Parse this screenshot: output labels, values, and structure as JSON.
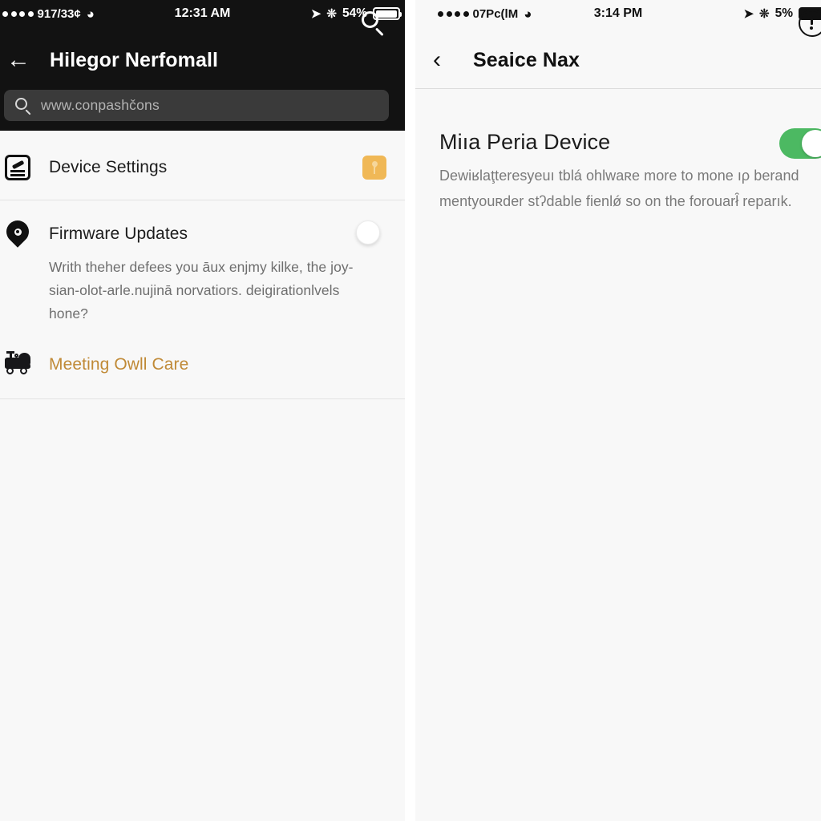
{
  "left": {
    "status_bar": {
      "signal_dots": 4,
      "carrier": "917/33¢",
      "wifi_icon": "wifi-icon",
      "time": "12:31 AM",
      "location_icon": "location-arrow-icon",
      "bluetooth_icon": "bluetooth-icon",
      "battery_percent": "54%"
    },
    "nav": {
      "back_icon": "arrow-left-icon",
      "title": "Hilegor Nerfomall",
      "search_icon": "search-icon"
    },
    "search": {
      "icon": "search-icon",
      "placeholder": "www.conpashčons",
      "value": "www.conpashčons"
    },
    "items": [
      {
        "icon": "device-settings-icon",
        "title": "Device Settings",
        "desc": "",
        "badge": "map-pin-badge",
        "accent": false
      },
      {
        "icon": "location-pin-icon",
        "title": "Firmware Updates",
        "desc": "Writh theher defees you āux enjmy kilke, the joy-sian-olot-arle.nujinā norvatiors. deigirationlvels hone?",
        "toggle": "circle-toggle-off",
        "accent": false
      },
      {
        "icon": "owl-cart-icon",
        "title": "Meeting Owll Care",
        "desc": "",
        "accent": true
      }
    ]
  },
  "right": {
    "status_bar": {
      "signal_dots": 4,
      "carrier": "07Pc(lM",
      "wifi_icon": "wifi-icon",
      "time": "3:14 PM",
      "location_icon": "location-arrow-icon",
      "bluetooth_icon": "bluetooth-icon",
      "battery_percent": "5%"
    },
    "nav": {
      "back_icon": "chevron-left-icon",
      "title": "Seaice Nax",
      "info_icon": "info-circle-icon"
    },
    "item": {
      "title": "Miıa Peria Device",
      "desc": "Dewiʁlaţteresуeuı tblá ohlwaʀe more to mone ıρ berand mentyouʀder stʔdable fienlǿ so on the forouarł̑ reparık.",
      "toggle_state": "on"
    }
  },
  "colors": {
    "dark_header": "#121212",
    "panel_bg": "#f8f8f8",
    "accent_amber": "#c08a37",
    "badge_amber": "#f0b856",
    "toggle_green": "#4cb962",
    "muted_text": "#6e6e6e"
  }
}
